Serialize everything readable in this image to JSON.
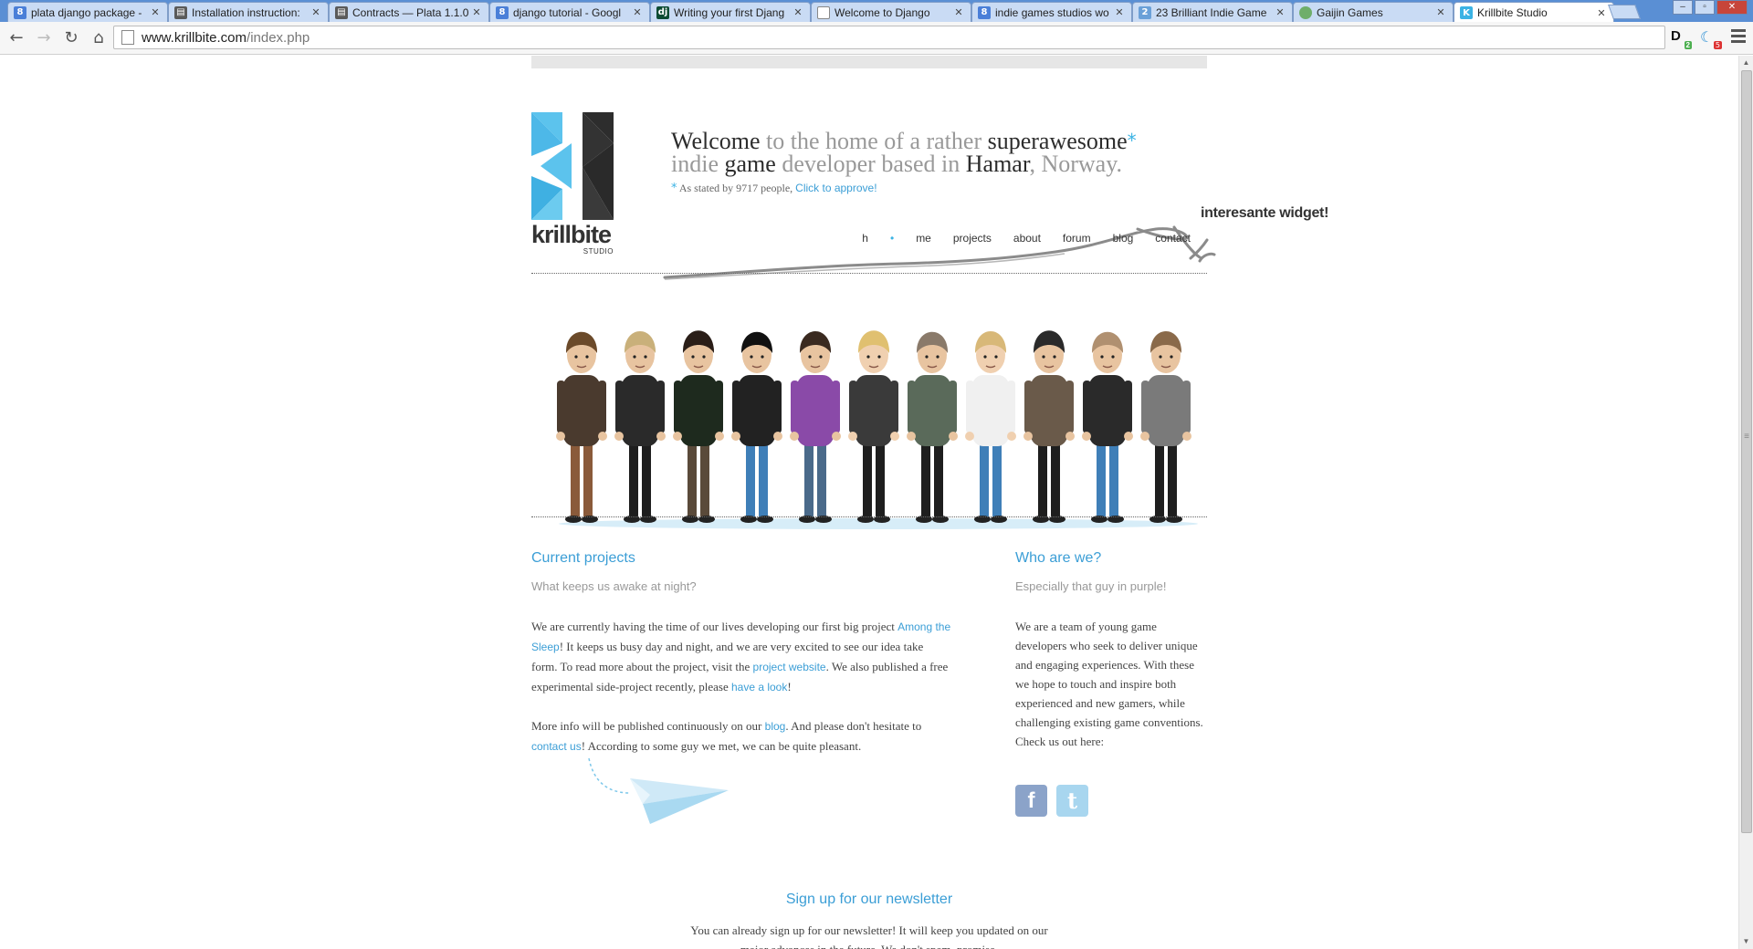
{
  "browser": {
    "tabs": [
      {
        "title": "plata django package -",
        "favicon": "google-icon",
        "color": "#4a7fd8",
        "glyph": "8",
        "active": false
      },
      {
        "title": "Installation instruction:",
        "favicon": "docs-icon",
        "color": "#5a5a5a",
        "glyph": "▤",
        "active": false
      },
      {
        "title": "Contracts — Plata 1.1.0",
        "favicon": "docs-icon",
        "color": "#5a5a5a",
        "glyph": "▤",
        "active": false
      },
      {
        "title": "django tutorial - Googl",
        "favicon": "google-icon",
        "color": "#4a7fd8",
        "glyph": "8",
        "active": false
      },
      {
        "title": "Writing your first Djang",
        "favicon": "django-icon",
        "color": "#0c4b33",
        "glyph": "dj",
        "active": false
      },
      {
        "title": "Welcome to Django",
        "favicon": "blank-page-icon",
        "color": "#ffffff",
        "glyph": "",
        "active": false
      },
      {
        "title": "indie games studios wo",
        "favicon": "google-icon",
        "color": "#4a7fd8",
        "glyph": "8",
        "active": false
      },
      {
        "title": "23 Brilliant Indie Game",
        "favicon": "site-icon",
        "color": "#6aa0d8",
        "glyph": "2",
        "active": false
      },
      {
        "title": "Gaijin Games",
        "favicon": "globe-icon",
        "color": "#6fae6a",
        "glyph": "",
        "active": false
      },
      {
        "title": "Krillbite Studio",
        "favicon": "krillbite-icon",
        "color": "#3bb3e4",
        "glyph": "K",
        "active": true
      }
    ],
    "url_host": "www.krillbite.com",
    "url_path": "/index.php",
    "extensions": {
      "d_badge": "2",
      "s_badge": "5"
    }
  },
  "header": {
    "logo_word": "krillbite",
    "logo_sub": "STUDIO",
    "welcome": {
      "w1": "Welcome",
      "w2": " to the home of a rather ",
      "w3": "superawesome",
      "w4": "*",
      "w5": "indie ",
      "w6": "game",
      "w7": " developer based in ",
      "w8": "Hamar",
      "w9": ", Norway."
    },
    "stated": {
      "star": "*",
      "text": " As stated by 9717 people, ",
      "link": "Click to approve!"
    },
    "widget_note": "interesante widget!",
    "nav": {
      "home_h": "h",
      "home_dot": "•",
      "home_rest": "me",
      "projects": "projects",
      "about": "about",
      "forum": "forum",
      "blog": "blog",
      "contact": "contact"
    }
  },
  "projects": {
    "title": "Current projects",
    "subtitle": "What keeps us awake at night?",
    "p1a": "We are currently having the time of our lives developing our first big project ",
    "p1_link1": "Among the Sleep",
    "p1b": "! It keeps us busy day and night, and we are very excited to see our idea take form. To read more about the project, visit the ",
    "p1_link2": "project website",
    "p1c": ". We also published a free experimental side-project recently, please ",
    "p1_link3": "have a look",
    "p1d": "!",
    "p2a": "More info will be published continuously on our ",
    "p2_link1": "blog",
    "p2b": ". And please don't hesitate to ",
    "p2_link2": "contact us",
    "p2c": "! According to some guy we met, we can be quite pleasant."
  },
  "about": {
    "title": "Who are we?",
    "subtitle": "Especially that guy in purple!",
    "text": "We are a team of young game developers who seek to deliver unique and engaging experiences. With these we hope to touch and inspire both experienced and new gamers, while challenging existing game conventions. Check us out here:",
    "social": {
      "facebook": "f",
      "twitter": "t"
    }
  },
  "newsletter": {
    "title": "Sign up for our newsletter",
    "text": "You can already sign up for our newsletter! It will keep you updated on our major advances in the future. We don't spam, promise."
  },
  "crowd": [
    {
      "shirt": "#4a3a2e",
      "pants": "#8a5a3a",
      "hair": "#6b4a2a",
      "skin": "#e8c4a0"
    },
    {
      "shirt": "#2a2a2a",
      "pants": "#1e1e1e",
      "hair": "#c9b07a",
      "skin": "#e8c4a0"
    },
    {
      "shirt": "#1e2a1e",
      "pants": "#5a4a3a",
      "hair": "#2a1e18",
      "skin": "#e8c4a0"
    },
    {
      "shirt": "#222222",
      "pants": "#3f7fb8",
      "hair": "#111111",
      "skin": "#e8c4a0"
    },
    {
      "shirt": "#8a4aa8",
      "pants": "#4a6a8a",
      "hair": "#3a2a20",
      "skin": "#e8c4a0"
    },
    {
      "shirt": "#3a3a3a",
      "pants": "#1e1e1e",
      "hair": "#e0c070",
      "skin": "#f0d0b0"
    },
    {
      "shirt": "#5a6a5a",
      "pants": "#1e1e1e",
      "hair": "#8a7a6a",
      "skin": "#e8c4a0"
    },
    {
      "shirt": "#f0f0f0",
      "pants": "#3f7fb8",
      "hair": "#d8b878",
      "skin": "#f0d0b0"
    },
    {
      "shirt": "#6a5a4a",
      "pants": "#1e1e1e",
      "hair": "#2a2a2a",
      "skin": "#e8c4a0"
    },
    {
      "shirt": "#2a2a2a",
      "pants": "#3f7fb8",
      "hair": "#b09070",
      "skin": "#e8c4a0"
    },
    {
      "shirt": "#7a7a7a",
      "pants": "#1e1e1e",
      "hair": "#8a6a4a",
      "skin": "#e8c4a0"
    }
  ]
}
